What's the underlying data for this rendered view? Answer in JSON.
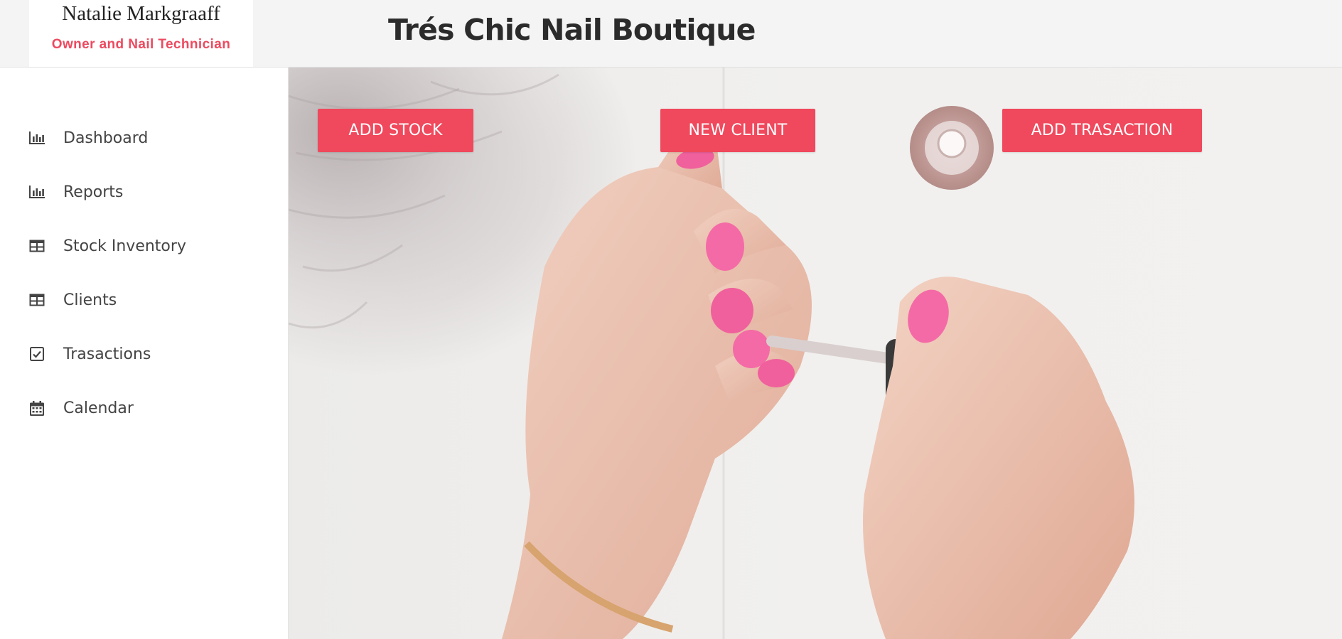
{
  "profile": {
    "name": "Natalie Markgraaff",
    "role": "Owner and Nail Technician"
  },
  "header": {
    "title": "Trés Chic Nail Boutique"
  },
  "nav": {
    "items": [
      {
        "label": "Dashboard",
        "icon": "bar-chart-icon"
      },
      {
        "label": "Reports",
        "icon": "bar-chart-icon"
      },
      {
        "label": "Stock Inventory",
        "icon": "table-icon"
      },
      {
        "label": "Clients",
        "icon": "table-icon"
      },
      {
        "label": "Trasactions",
        "icon": "checkbox-icon"
      },
      {
        "label": "Calendar",
        "icon": "calendar-icon"
      }
    ]
  },
  "actions": {
    "add_stock": "ADD STOCK",
    "new_client": "NEW CLIENT",
    "add_transaction": "ADD TRASACTION"
  },
  "colors": {
    "accent": "#f0485c",
    "role_text": "#ec4a5f",
    "header_bg": "#f4f4f4",
    "nail_pink": "#f0609c"
  }
}
